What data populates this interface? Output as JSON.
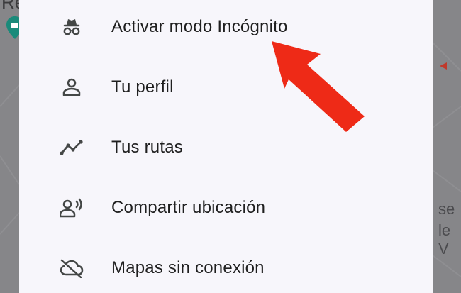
{
  "background": {
    "map_text_left": "Re",
    "map_text_right_lines": [
      "se",
      "le V"
    ]
  },
  "menu": {
    "items": [
      {
        "label": "Activar modo Incógnito",
        "icon": "incognito-icon"
      },
      {
        "label": "Tu perfil",
        "icon": "person-icon"
      },
      {
        "label": "Tus rutas",
        "icon": "timeline-icon"
      },
      {
        "label": "Compartir ubicación",
        "icon": "share-location-icon"
      },
      {
        "label": "Mapas sin conexión",
        "icon": "cloud-off-icon"
      }
    ]
  },
  "annotation": {
    "color": "#ee2a17",
    "points_to": "Activar modo Incógnito"
  },
  "colors": {
    "menu_background": "#f7f6fb",
    "text": "#1f1f1f",
    "icon": "#444746",
    "pin": "#1a8a7a"
  }
}
